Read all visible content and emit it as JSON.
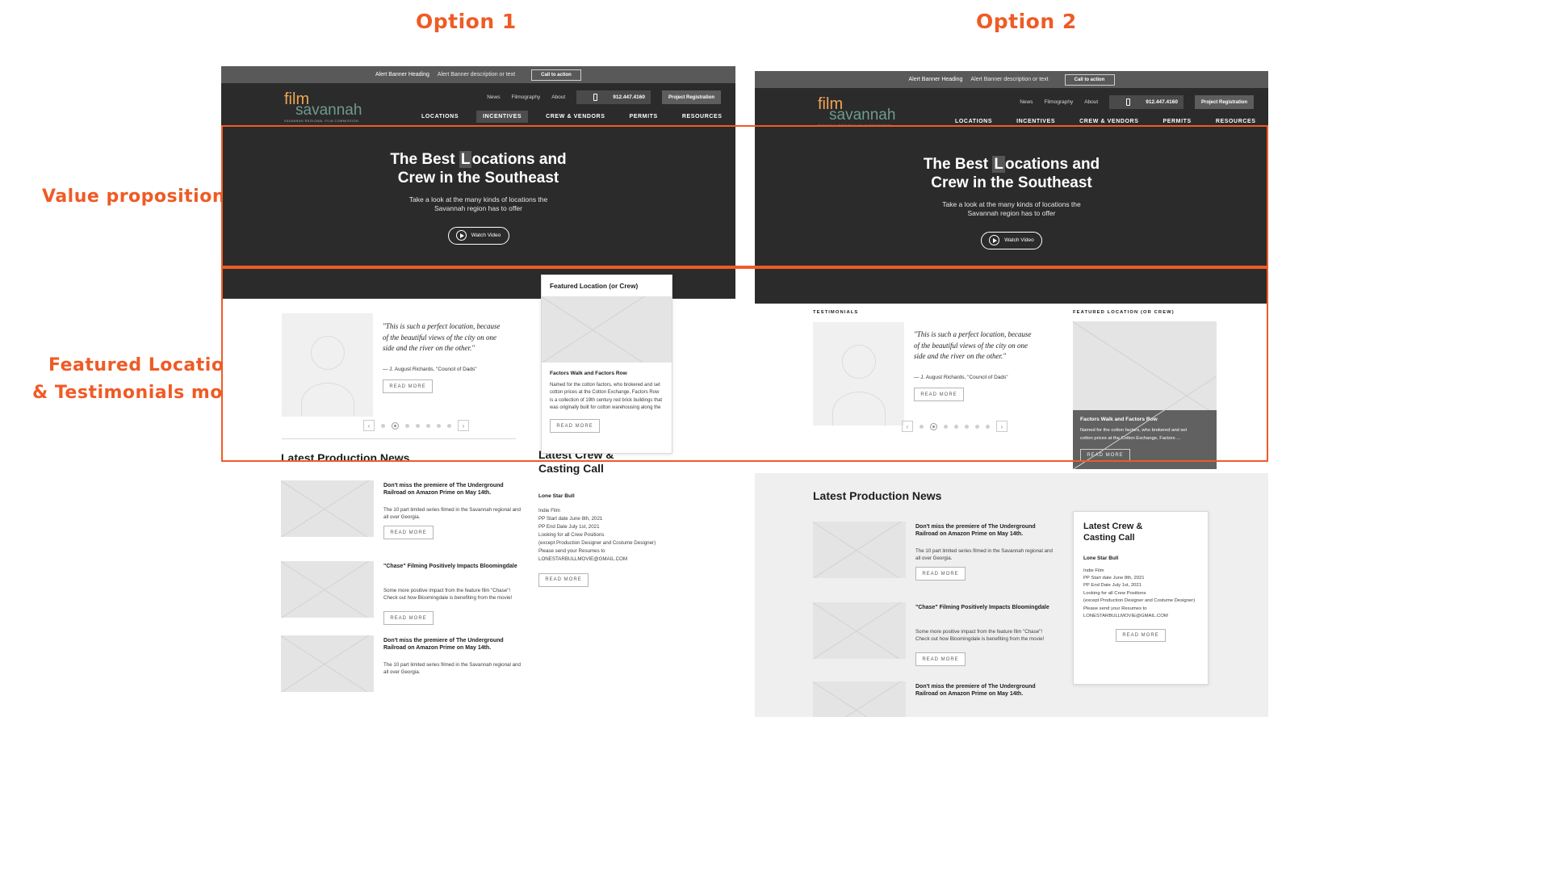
{
  "annotations": {
    "option1": "Option 1",
    "option2": "Option 2",
    "value_prop": "Value proposition",
    "featured_line1": "Featured Location",
    "featured_line2": "& Testimonials modules"
  },
  "alert_bar": {
    "heading": "Alert Banner Heading",
    "description": "Alert Banner description or text",
    "cta": "Call to action"
  },
  "logo": {
    "film": "film",
    "savannah": "savannah",
    "subtitle": "SAVANNAH REGIONAL FILM COMMISSION"
  },
  "util_nav": {
    "items": [
      "News",
      "Filmography",
      "About"
    ],
    "phone": "912.447.4160",
    "phone_icon": "mobile-phone-icon",
    "project_button": "Project Registration"
  },
  "main_nav": {
    "items": [
      {
        "label": "LOCATIONS",
        "active": false
      },
      {
        "label": "INCENTIVES",
        "active": true
      },
      {
        "label": "CREW & VENDORS",
        "active": false
      },
      {
        "label": "PERMITS",
        "active": false
      },
      {
        "label": "RESOURCES",
        "active": false
      }
    ]
  },
  "hero": {
    "title_line1_a": "The Best ",
    "title_line1_hl": "L",
    "title_line1_b": "ocations and",
    "title_line2": "Crew in the Southeast",
    "subtitle_line1": "Take a look at the many kinds of locations the",
    "subtitle_line2": "Savannah region has to offer",
    "watch_label": "Watch Video",
    "play_icon": "play-icon"
  },
  "testimonial": {
    "eyebrow": "TESTIMONIALS",
    "quote_line1": "\"This is such a perfect location, because",
    "quote_line2": "of the beautiful views of the city on one",
    "quote_line3": "side and the river on the other.\"",
    "attribution": "— J. August Richards, \"Council of Dads\"",
    "read_more": "READ MORE",
    "avatar": "person-placeholder-avatar"
  },
  "carousel": {
    "prev_icon": "chevron-left-icon",
    "next_icon": "chevron-right-icon",
    "dots": 7,
    "active_dot": 1
  },
  "featured": {
    "card_heading": "Featured Location (or Crew)",
    "eyebrow": "FEATURED LOCATION (OR CREW)",
    "title": "Factors Walk and Factors Row",
    "body_opt1": "Named for the cotton factors, who brokered and set cotton prices at the Cotton Exchange, Factors Row is a collection of 19th century red brick buildings that was originally built for cotton warehousing along the",
    "body_opt2_line1": "Named for the cotton factors, who brokered and set",
    "body_opt2_line2": "cotton prices at the Cotton Exchange, Factors ...",
    "read_more": "READ MORE",
    "image_placeholder": "featured-location-image-placeholder"
  },
  "news": {
    "section_title": "Latest Production News",
    "read_more": "READ MORE",
    "items": [
      {
        "title": "Don't miss the premiere of The Underground Railroad on Amazon Prime on May 14th.",
        "body": "The 10 part limited series filmed in the Savannah regional and all over Georgia.",
        "image_placeholder": "news-image-placeholder"
      },
      {
        "title": "\"Chase\" Filming Positively Impacts Bloomingdale",
        "body": "Some more positive impact from the feature film \"Chase\"! Check out how Bloomingdale is benefiting from the movie!",
        "image_placeholder": "news-image-placeholder"
      },
      {
        "title": "Don't miss the premiere of The Underground Railroad on Amazon Prime on May 14th.",
        "body": "The 10 part limited series filmed in the Savannah regional and all over Georgia.",
        "image_placeholder": "news-image-placeholder"
      }
    ]
  },
  "casting": {
    "title_line1": "Latest Crew &",
    "title_line2": "Casting Call",
    "project": "Lone Star Bull",
    "lines": [
      "Indie Film",
      "PP Start date June 8th, 2021",
      "PP End Date July 1st, 2021",
      "Looking for all Crew Positions",
      "(except Production Designer and Costume Designer)",
      "Please send your Resumes to",
      "LONESTARBULLMOVIE@GMAIL.COM"
    ],
    "read_more": "READ MORE"
  },
  "colors": {
    "accent": "#ef5b25",
    "dark": "#2b2b2b",
    "alert_grey": "#595959",
    "logo_orange": "#f0a555",
    "logo_green": "#6f9b8b"
  }
}
